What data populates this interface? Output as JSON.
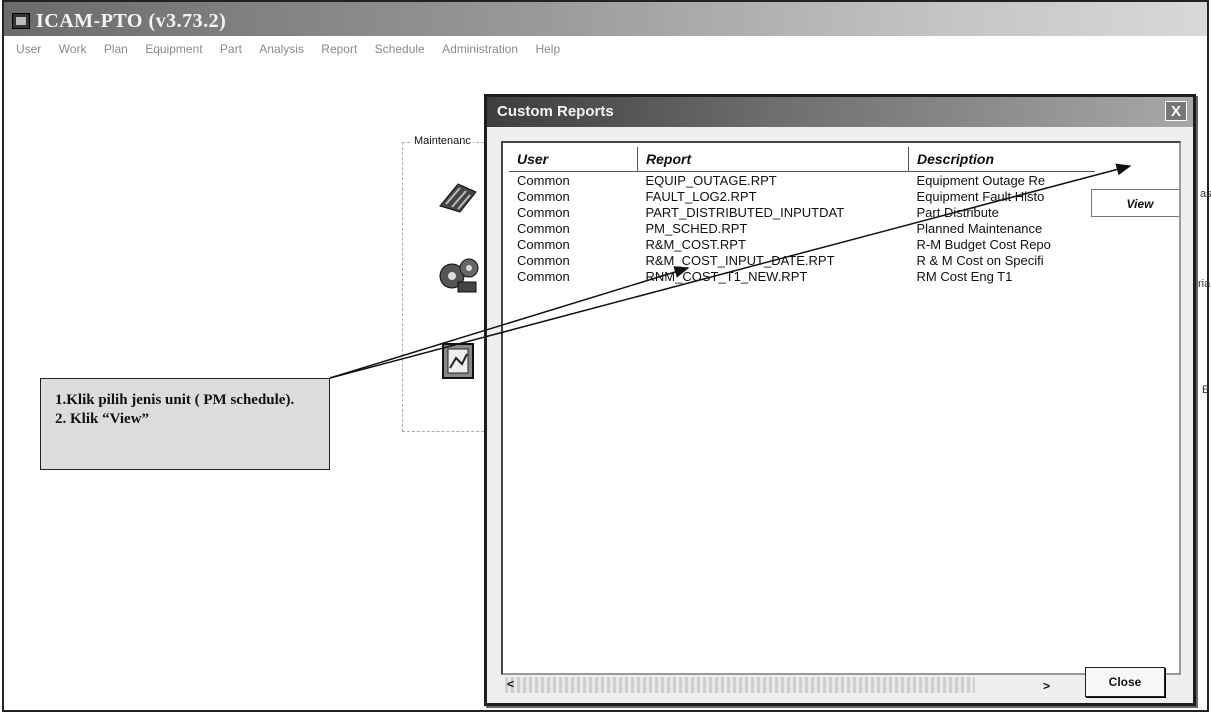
{
  "app": {
    "title": "ICAM-PTO (v3.73.2)",
    "menu": [
      "User",
      "Work",
      "Plan",
      "Equipment",
      "Part",
      "Analysis",
      "Report",
      "Schedule",
      "Administration",
      "Help"
    ]
  },
  "background": {
    "group_label": "Maintenanc",
    "edge_text_1": "asi",
    "edge_text_2": "ria",
    "edge_text_3": "E"
  },
  "callout": {
    "line1": "1.Klik  pilih jenis unit ( PM schedule).",
    "line2": "2. Klik “View”"
  },
  "dialog": {
    "title": "Custom Reports",
    "close_symbol": "X",
    "columns": [
      "User",
      "Report",
      "Description"
    ],
    "rows": [
      {
        "user": "Common",
        "report": "EQUIP_OUTAGE.RPT",
        "description": "Equipment Outage Re"
      },
      {
        "user": "Common",
        "report": "FAULT_LOG2.RPT",
        "description": "Equipment Fault Histo"
      },
      {
        "user": "Common",
        "report": "PART_DISTRIBUTED_INPUTDAT",
        "description": "Part Distribute"
      },
      {
        "user": "Common",
        "report": "PM_SCHED.RPT",
        "description": "Planned Maintenance"
      },
      {
        "user": "Common",
        "report": "R&M_COST.RPT",
        "description": "R-M Budget Cost Repo"
      },
      {
        "user": "Common",
        "report": "R&M_COST_INPUT_DATE.RPT",
        "description": "R & M Cost on Specifi"
      },
      {
        "user": "Common",
        "report": "RNM_COST_T1_NEW.RPT",
        "description": "RM Cost Eng T1"
      }
    ],
    "view_label": "View",
    "close_label": "Close",
    "scroll_left": "<",
    "scroll_right": ">"
  },
  "colors": {
    "titlebar": "#8a8a8a",
    "dialog_bg": "#efefef",
    "watermark": "#f2d98a"
  }
}
